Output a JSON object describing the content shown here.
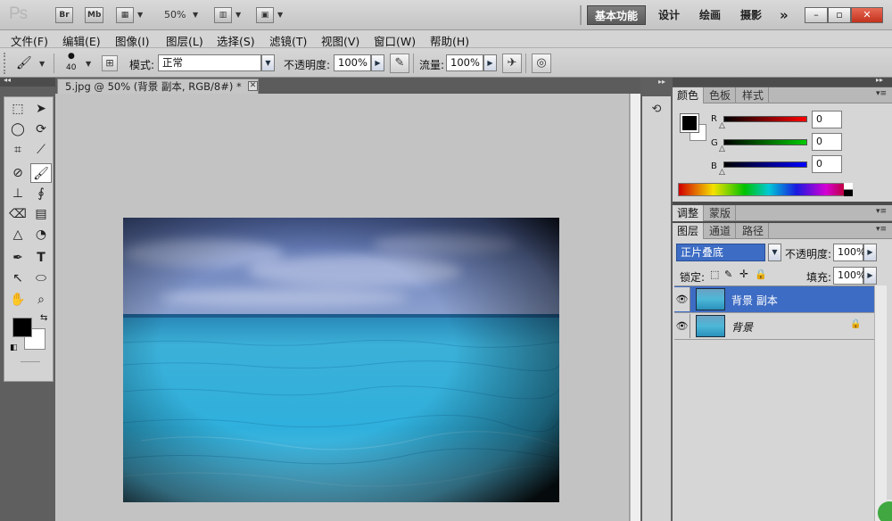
{
  "app": {
    "logo": "Ps",
    "bridge": "Br",
    "minibridge": "Mb",
    "zoom": "50%",
    "workspaces": [
      "基本功能",
      "设计",
      "绘画",
      "摄影"
    ],
    "more": "»",
    "win_min": "–",
    "win_max": "▫",
    "win_close": "✕"
  },
  "menu": [
    "文件(F)",
    "编辑(E)",
    "图像(I)",
    "图层(L)",
    "选择(S)",
    "滤镜(T)",
    "视图(V)",
    "窗口(W)",
    "帮助(H)"
  ],
  "options": {
    "brush_size": "40",
    "mode_label": "模式:",
    "mode_value": "正常",
    "opacity_label": "不透明度:",
    "opacity_value": "100%",
    "flow_label": "流量:",
    "flow_value": "100%"
  },
  "document": {
    "tab_title": "5.jpg @ 50% (背景 副本, RGB/8#) *",
    "tab_close": "✕"
  },
  "color_panel": {
    "tabs": [
      "颜色",
      "色板",
      "样式"
    ],
    "channels": [
      {
        "label": "R",
        "value": "0"
      },
      {
        "label": "G",
        "value": "0"
      },
      {
        "label": "B",
        "value": "0"
      }
    ]
  },
  "adjust_panel": {
    "tabs": [
      "调整",
      "蒙版"
    ]
  },
  "layers_panel": {
    "tabs": [
      "图层",
      "通道",
      "路径"
    ],
    "blend_mode": "正片叠底",
    "opacity_label": "不透明度:",
    "opacity_value": "100%",
    "lock_label": "锁定:",
    "fill_label": "填充:",
    "fill_value": "100%",
    "layers": [
      {
        "name": "背景 副本",
        "selected": true
      },
      {
        "name": "背景",
        "selected": false
      }
    ]
  },
  "colors": {
    "accent": "#3d6cc4",
    "workspace_active": "#6b6b6b"
  }
}
